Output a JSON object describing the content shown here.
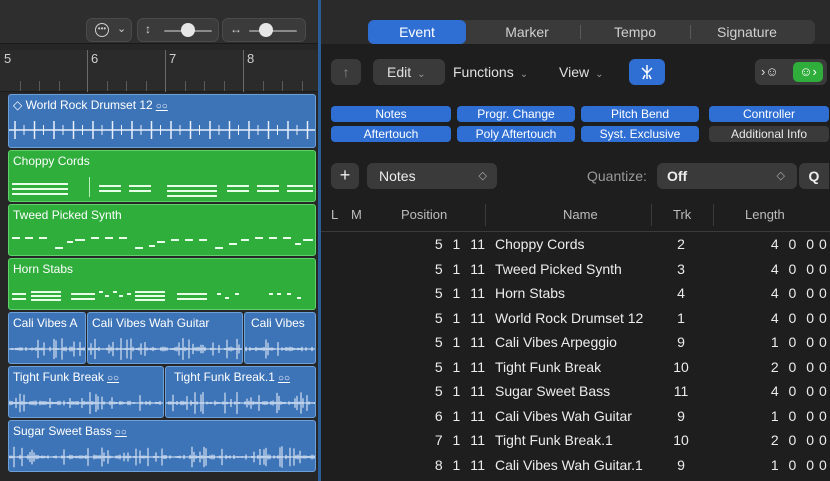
{
  "left_toolbar": {
    "more_icon": "ellipsis-circle-icon",
    "vertical_zoom_icon": "vertical-arrows-icon",
    "horizontal_zoom_icon": "horizontal-arrows-icon"
  },
  "ruler": {
    "bars": [
      "5",
      "6",
      "7",
      "8"
    ]
  },
  "regions": {
    "world_rock": "World Rock Drumset 12",
    "choppy": "Choppy Cords",
    "tweed": "Tweed Picked Synth",
    "horn": "Horn Stabs",
    "cali_a": "Cali Vibes A",
    "cali_wah": "Cali Vibes Wah Guitar",
    "cali_b": "Cali Vibes",
    "tight": "Tight Funk Break",
    "tight1": "Tight Funk Break.1",
    "sugar": "Sugar Sweet Bass",
    "loop_glyph": "○○",
    "loop_glyph2": "○○"
  },
  "tabs": [
    "Event",
    "Marker",
    "Tempo",
    "Signature"
  ],
  "menu": {
    "up_icon": "↑",
    "edit": "Edit",
    "functions": "Functions",
    "view": "View",
    "midi_in_icon": "MIDI in",
    "midi_out_icon": "MIDI out"
  },
  "filters": [
    {
      "label": "Notes",
      "on": true
    },
    {
      "label": "Progr. Change",
      "on": true
    },
    {
      "label": "Pitch Bend",
      "on": true
    },
    {
      "label": "Controller",
      "on": true
    },
    {
      "label": "Aftertouch",
      "on": true
    },
    {
      "label": "Poly Aftertouch",
      "on": true
    },
    {
      "label": "Syst. Exclusive",
      "on": true
    },
    {
      "label": "Additional Info",
      "on": false
    }
  ],
  "editrow": {
    "add": "+",
    "type": "Notes",
    "quantize_label": "Quantize:",
    "quantize_value": "Off",
    "q": "Q"
  },
  "columns": {
    "l": "L",
    "m": "M",
    "position": "Position",
    "name": "Name",
    "trk": "Trk",
    "length": "Length"
  },
  "rows": [
    {
      "pos": "5 1 1",
      "one": "1",
      "name": "Choppy Cords",
      "trk": "2",
      "len": "4 0 0",
      "extra": "0"
    },
    {
      "pos": "5 1 1",
      "one": "1",
      "name": "Tweed Picked Synth",
      "trk": "3",
      "len": "4 0 0",
      "extra": "0"
    },
    {
      "pos": "5 1 1",
      "one": "1",
      "name": "Horn Stabs",
      "trk": "4",
      "len": "4 0 0",
      "extra": "0"
    },
    {
      "pos": "5 1 1",
      "one": "1",
      "name": "World Rock Drumset 12",
      "trk": "1",
      "len": "4 0 0",
      "extra": "0"
    },
    {
      "pos": "5 1 1",
      "one": "1",
      "name": "Cali Vibes Arpeggio",
      "trk": "9",
      "len": "1 0 0",
      "extra": "0"
    },
    {
      "pos": "5 1 1",
      "one": "1",
      "name": "Tight Funk Break",
      "trk": "10",
      "len": "2 0 0",
      "extra": "0"
    },
    {
      "pos": "5 1 1",
      "one": "1",
      "name": "Sugar Sweet Bass",
      "trk": "11",
      "len": "4 0 0",
      "extra": "0"
    },
    {
      "pos": "6 1 1",
      "one": "1",
      "name": "Cali Vibes Wah Guitar",
      "trk": "9",
      "len": "1 0 0",
      "extra": "0"
    },
    {
      "pos": "7 1 1",
      "one": "1",
      "name": "Tight Funk Break.1",
      "trk": "10",
      "len": "2 0 0",
      "extra": "0"
    },
    {
      "pos": "8 1 1",
      "one": "1",
      "name": "Cali Vibes Wah Guitar.1",
      "trk": "9",
      "len": "1 0 0",
      "extra": "0"
    }
  ],
  "colors": {
    "accent": "#2f6fd4",
    "audio_region": "#3d74b8",
    "midi_region": "#2fae3c"
  }
}
